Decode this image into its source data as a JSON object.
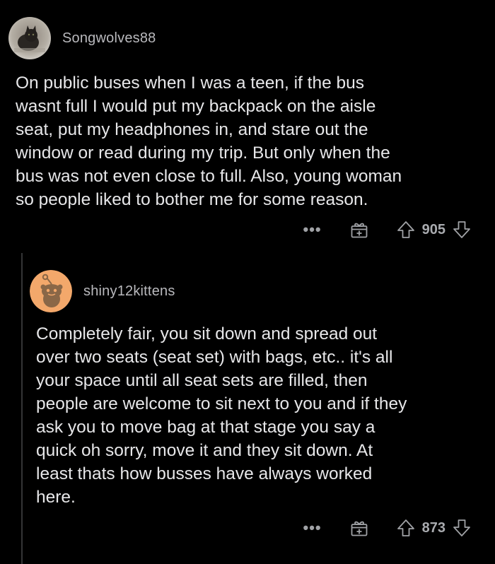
{
  "comments": [
    {
      "username": "Songwolves88",
      "avatar": "dark-cat-photo-icon",
      "body": "On public buses when I was a teen, if the bus\nwasnt full I would put my backpack on the aisle\nseat, put my headphones in, and stare out the\nwindow or read during my trip. But only when the\nbus was not even close to full. Also, young woman\nso people liked to bother me for some reason.",
      "score": "905",
      "more_label": "•••"
    },
    {
      "username": "shiny12kittens",
      "avatar": "snoo-avatar-icon",
      "body": "Completely fair, you sit down and spread out\nover two seats (seat set) with bags, etc.. it's all\nyour space until all seat sets are filled, then\npeople are welcome to sit next to you and if they\nask you to move bag at that stage you say a\nquick oh sorry, move it and they sit down. At\nleast thats how busses have always worked\nhere.",
      "score": "873",
      "more_label": "•••"
    }
  ],
  "colors": {
    "background": "#000000",
    "text": "#e7e7e9",
    "meta": "#9a9ca0",
    "thread_line": "#343536",
    "snoo_bg": "#f3a86b"
  },
  "icons": [
    "more-icon",
    "award-gift-icon",
    "upvote-arrow-icon",
    "downvote-arrow-icon"
  ]
}
